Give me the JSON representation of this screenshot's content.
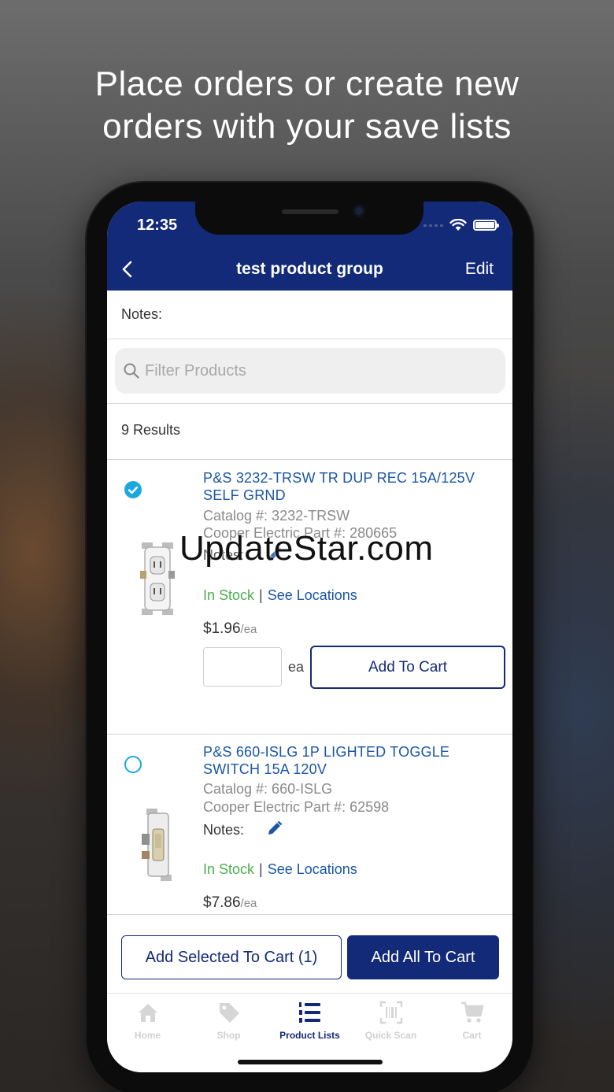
{
  "headline": {
    "line1": "Place orders or create new",
    "line2": "orders with your save lists"
  },
  "status_bar": {
    "time": "12:35",
    "icons": [
      "signal-icon",
      "wifi-icon",
      "battery-icon"
    ]
  },
  "nav": {
    "back_icon": "chevron-left-icon",
    "title": "test product group",
    "edit_label": "Edit"
  },
  "notes_label": "Notes:",
  "filter": {
    "placeholder": "Filter Products",
    "icon": "search-icon"
  },
  "results_text": "9 Results",
  "items": [
    {
      "selected": true,
      "name": "P&S 3232-TRSW TR DUP REC 15A/125V SELF GRND",
      "catalog": "Catalog #: 3232-TRSW",
      "part": "Cooper Electric Part #: 280665",
      "notes_label": "Notes:",
      "stock": "In Stock",
      "separator": "|",
      "locations": "See Locations",
      "price": "$1.96",
      "unit": "/ea",
      "qty_unit": "ea",
      "add_to_cart": "Add To Cart"
    },
    {
      "selected": false,
      "name": "P&S 660-ISLG 1P LIGHTED TOGGLE SWITCH 15A 120V",
      "catalog": "Catalog #: 660-ISLG",
      "part": "Cooper Electric Part #: 62598",
      "notes_label": "Notes:",
      "stock": "In Stock",
      "separator": "|",
      "locations": "See Locations",
      "price": "$7.86",
      "unit": "/ea"
    }
  ],
  "actions": {
    "add_selected": "Add Selected To Cart (1)",
    "add_all": "Add All To Cart"
  },
  "tabs": [
    {
      "label": "Home",
      "icon": "home-icon"
    },
    {
      "label": "Shop",
      "icon": "tag-icon"
    },
    {
      "label": "Product Lists",
      "icon": "numbered-list-icon"
    },
    {
      "label": "Quick Scan",
      "icon": "barcode-scan-icon"
    },
    {
      "label": "Cart",
      "icon": "cart-icon"
    }
  ],
  "active_tab": "Product Lists",
  "watermark": "UpdateStar.com",
  "colors": {
    "brand_navy": "#132a78",
    "link_blue": "#1a56a8",
    "stock_green": "#4caf50",
    "check_cyan": "#1ba8e0"
  }
}
